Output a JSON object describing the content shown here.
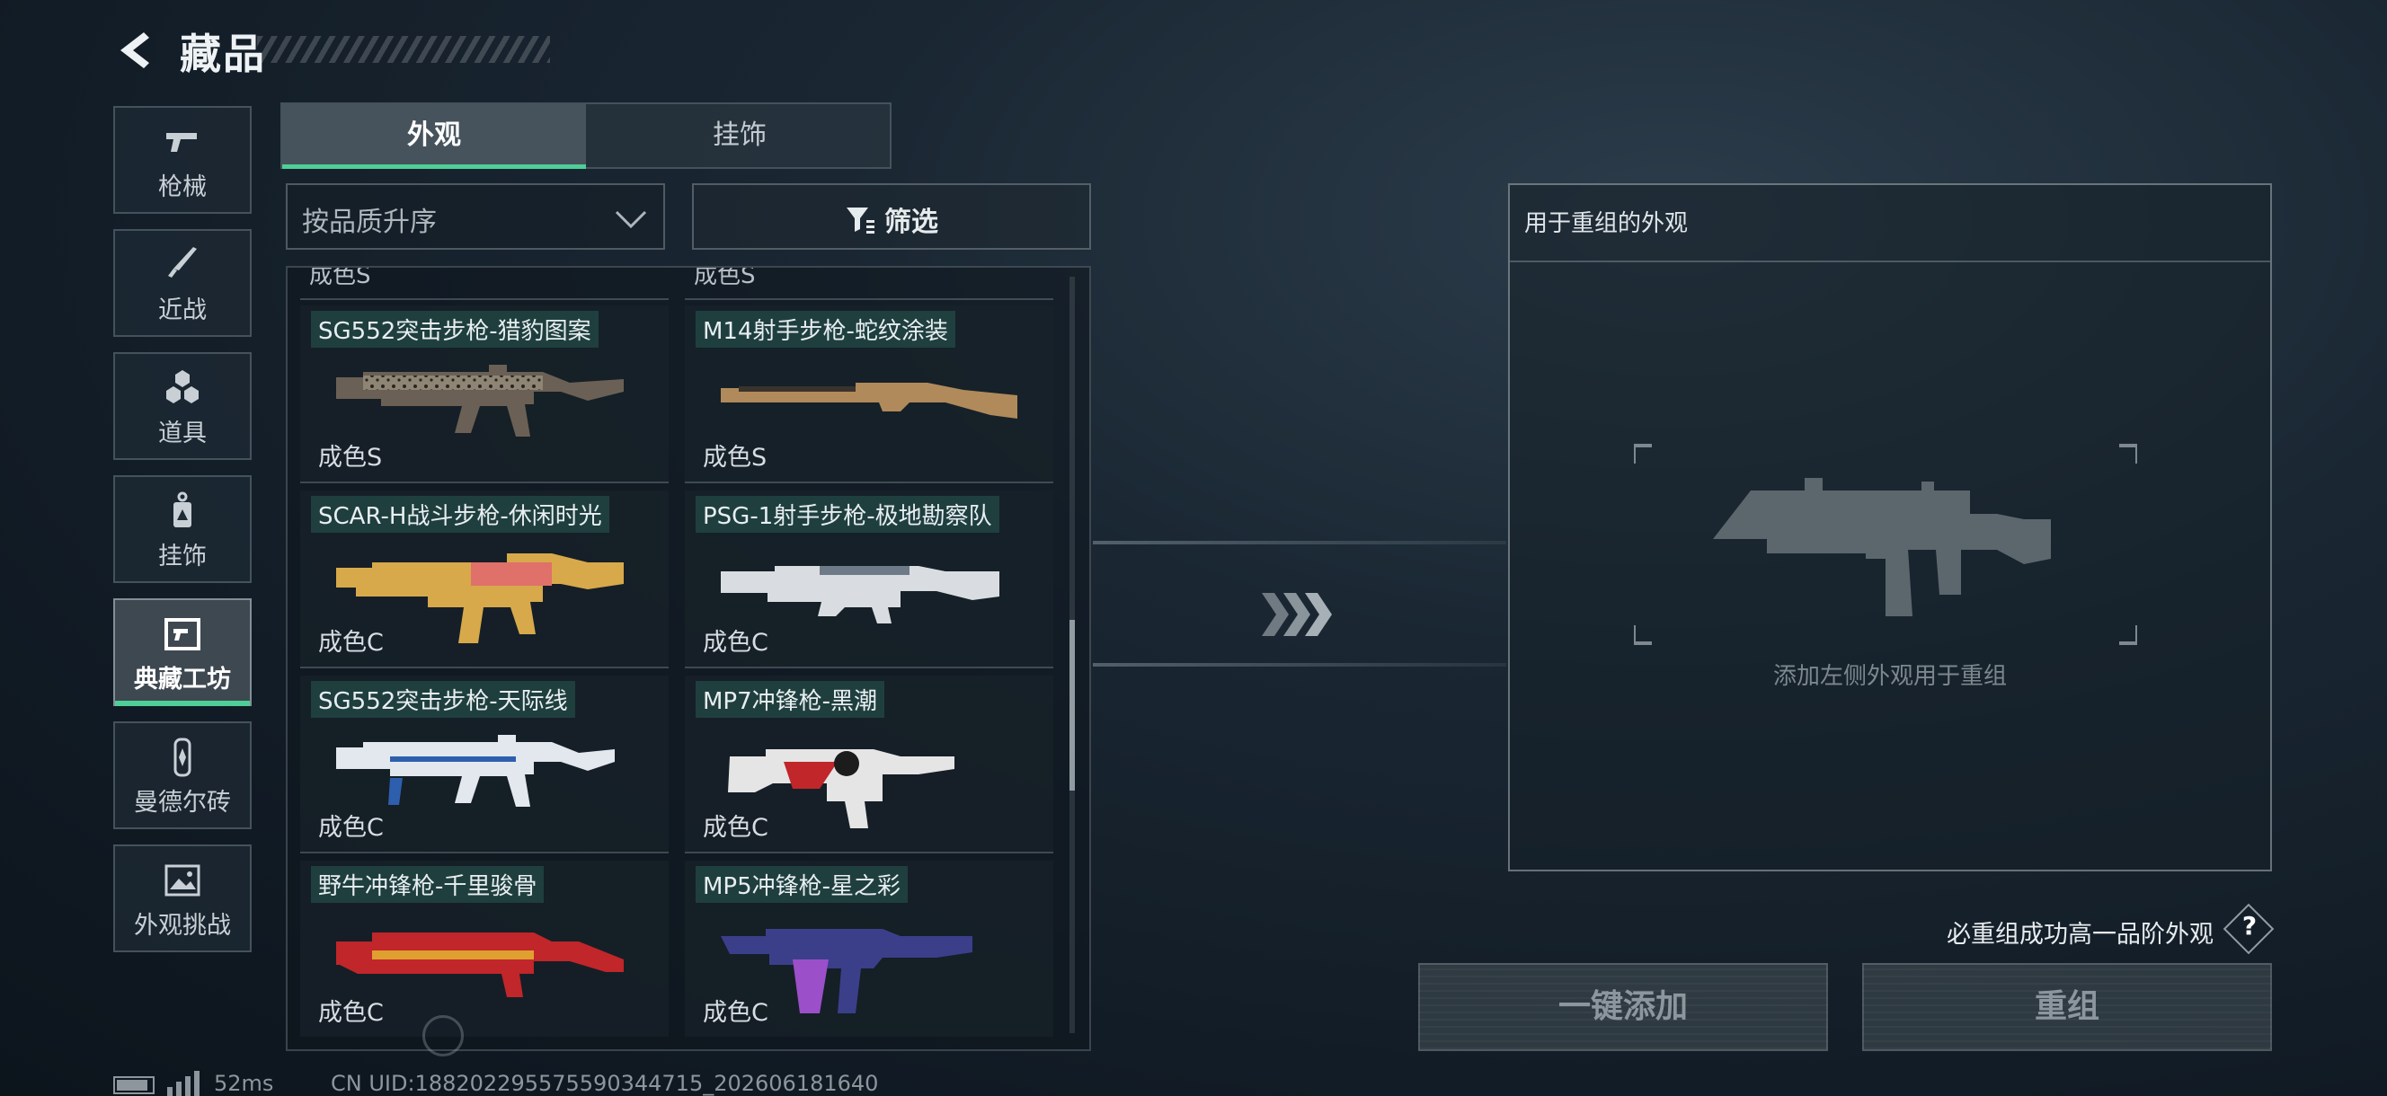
{
  "header": {
    "title": "藏品",
    "back_icon": "chevron-left-icon"
  },
  "nav": [
    {
      "label": "枪械",
      "icon": "pistol-icon",
      "active": false
    },
    {
      "label": "近战",
      "icon": "knife-icon",
      "active": false
    },
    {
      "label": "道具",
      "icon": "hexagon-cluster-icon",
      "active": false
    },
    {
      "label": "挂饰",
      "icon": "charm-tag-icon",
      "active": false
    },
    {
      "label": "典藏工坊",
      "icon": "workshop-frame-icon",
      "active": true
    },
    {
      "label": "曼德尔砖",
      "icon": "mandel-brick-icon",
      "active": false
    },
    {
      "label": "外观挑战",
      "icon": "challenge-image-icon",
      "active": false
    }
  ],
  "tabs": {
    "appearance": "外观",
    "pendant": "挂饰",
    "active": "外观"
  },
  "sort": {
    "label": "按品质升序"
  },
  "filter": {
    "label": "筛选"
  },
  "list": {
    "partial_grade_left": "成色S",
    "partial_grade_right": "成色S",
    "items": [
      {
        "name": "SG552突击步枪-猎豹图案",
        "grade": "成色S",
        "skin": "leopard"
      },
      {
        "name": "M14射手步枪-蛇纹涂装",
        "grade": "成色S",
        "skin": "snake"
      },
      {
        "name": "SCAR-H战斗步枪-休闲时光",
        "grade": "成色C",
        "skin": "leisure"
      },
      {
        "name": "PSG-1射手步枪-极地勘察队",
        "grade": "成色C",
        "skin": "polar"
      },
      {
        "name": "SG552突击步枪-天际线",
        "grade": "成色C",
        "skin": "skyline"
      },
      {
        "name": "MP7冲锋枪-黑潮",
        "grade": "成色C",
        "skin": "blacktide"
      },
      {
        "name": "野牛冲锋枪-千里骏骨",
        "grade": "成色C",
        "skin": "steed"
      },
      {
        "name": "MP5冲锋枪-星之彩",
        "grade": "成色C",
        "skin": "starcolor"
      }
    ]
  },
  "panel": {
    "title": "用于重组的外观",
    "hint": "添加左侧外观用于重组"
  },
  "guarantee": {
    "text": "必重组成功高一品阶外观",
    "help": "?"
  },
  "buttons": {
    "add_all": "一键添加",
    "reorganize": "重组"
  },
  "status": {
    "ping": "52ms",
    "uid": "CN UID:18820229557559034471​5_202606181640"
  },
  "colors": {
    "accent": "#4ecf98"
  }
}
